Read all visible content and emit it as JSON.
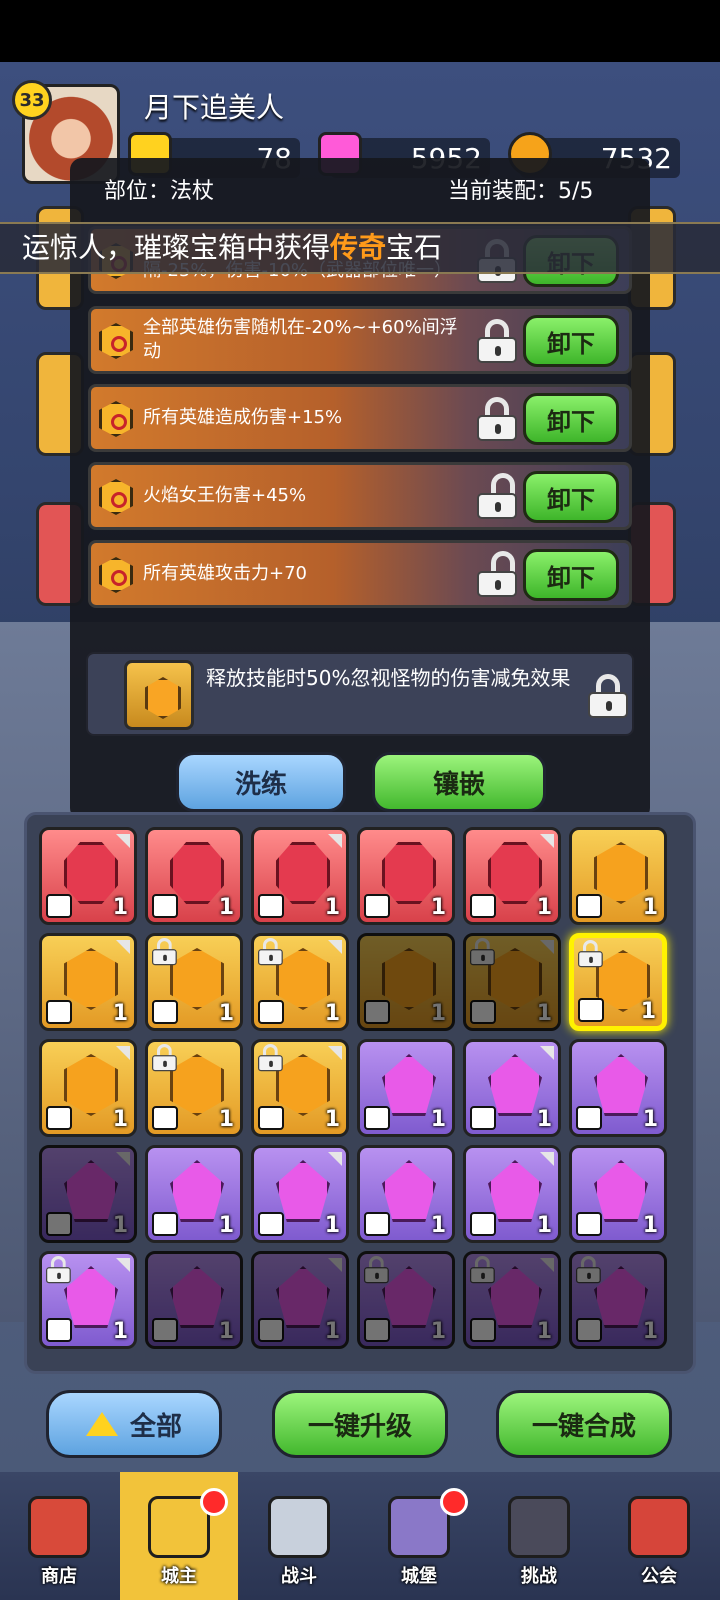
{
  "player": {
    "level": "33",
    "name": "月下追美人"
  },
  "resources": [
    {
      "icon": "gold-gem-icon",
      "value": "78"
    },
    {
      "icon": "pink-crystal-icon",
      "value": "5952"
    },
    {
      "icon": "coin-icon",
      "value": "7532"
    }
  ],
  "panel": {
    "slot_label": "部位：法杖",
    "equip_label": "当前装配：5/5",
    "banner_prefix": "运惊人，璀璨宝箱中获得",
    "banner_highlight": "传奇",
    "banner_suffix": "宝石",
    "rows": [
      {
        "text": "隔-25%，伤害-10%（武器部位唯一）",
        "locked": true,
        "button": "卸下"
      },
      {
        "text": "全部英雄伤害随机在-20%~+60%间浮动",
        "locked": true,
        "button": "卸下"
      },
      {
        "text": "所有英雄造成伤害+15%",
        "locked": true,
        "button": "卸下"
      },
      {
        "text": "火焰女王伤害+45%",
        "locked": false,
        "button": "卸下"
      },
      {
        "text": "所有英雄攻击力+70",
        "locked": false,
        "button": "卸下"
      }
    ],
    "passive_text": "释放技能时50%忽视怪物的伤害减免效果",
    "refine_button": "洗练",
    "inlay_button": "镶嵌"
  },
  "inventory": [
    {
      "color": "red",
      "count": "1",
      "locked": false
    },
    {
      "color": "red",
      "count": "1",
      "locked": false
    },
    {
      "color": "red",
      "count": "1",
      "locked": false
    },
    {
      "color": "red",
      "count": "1",
      "locked": false
    },
    {
      "color": "red",
      "count": "1",
      "locked": false
    },
    {
      "color": "gold",
      "count": "1",
      "locked": false
    },
    {
      "color": "gold",
      "count": "1",
      "locked": false
    },
    {
      "color": "gold",
      "count": "1",
      "locked": true
    },
    {
      "color": "gold",
      "count": "1",
      "locked": true
    },
    {
      "color": "gold",
      "count": "1",
      "locked": false,
      "dim": true
    },
    {
      "color": "gold",
      "count": "1",
      "locked": true,
      "dim": true
    },
    {
      "color": "gold",
      "count": "1",
      "locked": true,
      "selected": true
    },
    {
      "color": "gold",
      "count": "1",
      "locked": false
    },
    {
      "color": "gold",
      "count": "1",
      "locked": true
    },
    {
      "color": "gold",
      "count": "1",
      "locked": true
    },
    {
      "color": "purple",
      "count": "1",
      "locked": false
    },
    {
      "color": "purple",
      "count": "1",
      "locked": false
    },
    {
      "color": "purple",
      "count": "1",
      "locked": false
    },
    {
      "color": "purple",
      "count": "1",
      "locked": false,
      "dim": true
    },
    {
      "color": "purple",
      "count": "1",
      "locked": false
    },
    {
      "color": "purple",
      "count": "1",
      "locked": false
    },
    {
      "color": "purple",
      "count": "1",
      "locked": false
    },
    {
      "color": "purple",
      "count": "1",
      "locked": false
    },
    {
      "color": "purple",
      "count": "1",
      "locked": false
    },
    {
      "color": "purple",
      "count": "1",
      "locked": true
    },
    {
      "color": "purple",
      "count": "1",
      "locked": false,
      "dim": true
    },
    {
      "color": "purple",
      "count": "1",
      "locked": false,
      "dim": true
    },
    {
      "color": "purple",
      "count": "1",
      "locked": true,
      "dim": true
    },
    {
      "color": "purple",
      "count": "1",
      "locked": true,
      "dim": true
    },
    {
      "color": "purple",
      "count": "1",
      "locked": true,
      "dim": true
    }
  ],
  "actions": {
    "all": "全部",
    "upgrade": "一键升级",
    "merge": "一键合成"
  },
  "nav": [
    {
      "label": "商店",
      "active": false,
      "badge": false
    },
    {
      "label": "城主",
      "active": true,
      "badge": true
    },
    {
      "label": "战斗",
      "active": false,
      "badge": false
    },
    {
      "label": "城堡",
      "active": false,
      "badge": true
    },
    {
      "label": "挑战",
      "active": false,
      "badge": false
    },
    {
      "label": "公会",
      "active": false,
      "badge": false
    }
  ]
}
